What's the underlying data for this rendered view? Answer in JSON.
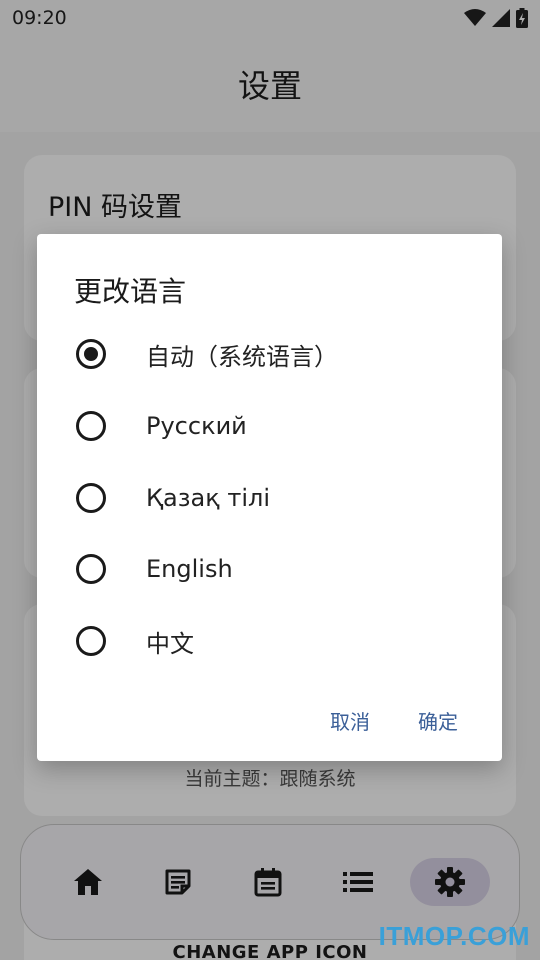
{
  "status_bar": {
    "time": "09:20"
  },
  "app_bar": {
    "title": "设置"
  },
  "cards": {
    "pin_title": "PIN 码设置",
    "theme_status": "当前主题：跟随系统",
    "bottom_label": "CHANGE APP ICON"
  },
  "dialog": {
    "title": "更改语言",
    "options": [
      {
        "label": "自动（系统语言）",
        "selected": true
      },
      {
        "label": "Русский",
        "selected": false
      },
      {
        "label": "Қазақ тілі",
        "selected": false
      },
      {
        "label": "English",
        "selected": false
      },
      {
        "label": "中文",
        "selected": false
      }
    ],
    "cancel": "取消",
    "confirm": "确定"
  },
  "bottom_nav": {
    "items": [
      {
        "icon": "home-icon",
        "active": false
      },
      {
        "icon": "notes-icon",
        "active": false
      },
      {
        "icon": "calendar-icon",
        "active": false
      },
      {
        "icon": "list-icon",
        "active": false
      },
      {
        "icon": "settings-gear-icon",
        "active": true
      }
    ]
  },
  "watermark": "ITMOP.COM",
  "colors": {
    "accent": "#3b5f98",
    "nav_active": "#d9d3e8"
  }
}
